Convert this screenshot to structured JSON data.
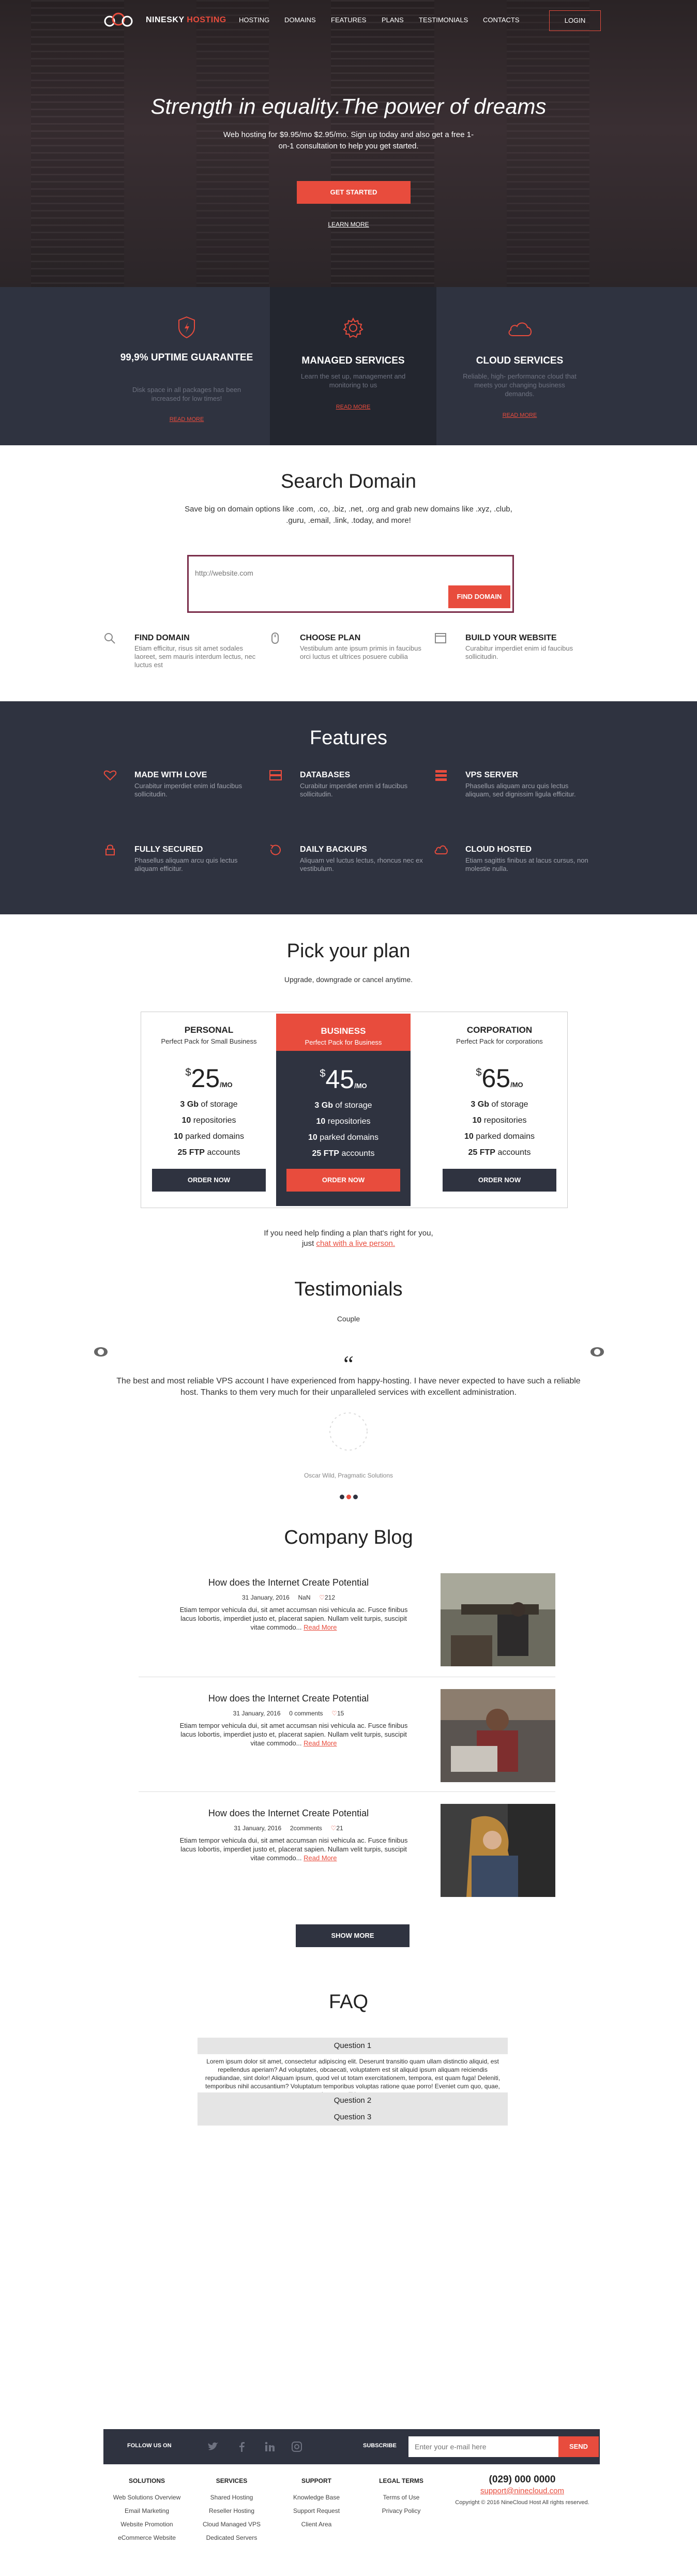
{
  "brand": {
    "name_part1": "NINESKY",
    "name_part2": "HOSTING"
  },
  "nav": {
    "items": [
      "HOSTING",
      "DOMAINS",
      "FEATURES",
      "PLANS",
      "TESTIMONIALS",
      "CONTACTS"
    ],
    "login": "LOGIN"
  },
  "hero": {
    "title": "Strength in equality.The power of dreams",
    "subtitle": "Web hosting for $9.95/mo $2.95/mo. Sign up today and also get a free 1-on-1 consultation to help you get started.",
    "cta": "GET STARTED",
    "learn_more": "LEARN MORE"
  },
  "services": [
    {
      "icon": "shield-icon",
      "title": "99,9% UPTIME GUARANTEE",
      "desc": "Disk space in all packages has been increased for low times!",
      "read": "READ MORE"
    },
    {
      "icon": "gear-icon",
      "title": "MANAGED SERVICES",
      "desc": "Learn the set up, management and monitoring to us",
      "read": "READ MORE"
    },
    {
      "icon": "cloud-icon",
      "title": "CLOUD SERVICES",
      "desc": "Reliable, high- performance cloud that meets your changing business demands.",
      "read": "READ MORE"
    }
  ],
  "search": {
    "title": "Search Domain",
    "desc": "Save big on domain options like .com, .co, .biz, .net, .org and grab new domains like .xyz, .club, .guru, .email, .link, .today, and more!",
    "placeholder": "http://website.com",
    "button": "FIND DOMAIN",
    "steps": [
      {
        "icon": "search-icon",
        "title": "FIND DOMAIN",
        "desc": "Etiam efficitur, risus sit amet sodales laoreet, sem mauris interdum lectus, nec luctus est"
      },
      {
        "icon": "mouse-icon",
        "title": "CHOOSE PLAN",
        "desc": "Vestibulum ante ipsum primis in faucibus orci luctus et ultrices posuere cubilia"
      },
      {
        "icon": "browser-icon",
        "title": "BUILD YOUR WEBSITE",
        "desc": "Curabitur imperdiet enim id faucibus sollicitudin."
      }
    ]
  },
  "features": {
    "title": "Features",
    "items": [
      {
        "icon": "heart-icon",
        "title": "MADE WITH LOVE",
        "desc": "Curabitur imperdiet enim id faucibus sollicitudin."
      },
      {
        "icon": "database-icon",
        "title": "DATABASES",
        "desc": "Curabitur imperdiet enim id faucibus sollicitudin."
      },
      {
        "icon": "server-icon",
        "title": "VPS SERVER",
        "desc": "Phasellus aliquam arcu quis lectus aliquam, sed dignissim ligula efficitur."
      },
      {
        "icon": "lock-icon",
        "title": "FULLY SECURED",
        "desc": "Phasellus aliquam arcu quis lectus aliquam efficitur."
      },
      {
        "icon": "backup-icon",
        "title": "DAILY BACKUPS",
        "desc": "Aliquam vel luctus lectus, rhoncus nec ex vestibulum."
      },
      {
        "icon": "cloud-icon",
        "title": "CLOUD HOSTED",
        "desc": "Etiam sagittis finibus at lacus cursus, non molestie nulla."
      }
    ]
  },
  "plans": {
    "title": "Pick your plan",
    "subtitle": "Upgrade, downgrade or cancel anytime.",
    "items": [
      {
        "name": "PERSONAL",
        "sub": "Perfect Pack for Small Business",
        "price": "25",
        "per": "/MO",
        "storage": "3 Gb",
        "storage_label": "of storage",
        "repos": "10",
        "repos_label": "repositories",
        "domains": "10",
        "domains_label": "parked domains",
        "ftp": "25 FTP",
        "ftp_label": "accounts",
        "order": "ORDER NOW"
      },
      {
        "name": "BUSINESS",
        "sub": "Perfect Pack for Business",
        "price": "45",
        "per": "/MO",
        "storage": "3 Gb",
        "storage_label": "of storage",
        "repos": "10",
        "repos_label": "repositories",
        "domains": "10",
        "domains_label": "parked domains",
        "ftp": "25 FTP",
        "ftp_label": "accounts",
        "order": "ORDER NOW"
      },
      {
        "name": "CORPORATION",
        "sub": "Perfect Pack for corporations",
        "price": "65",
        "per": "/MO",
        "storage": "3 Gb",
        "storage_label": "of storage",
        "repos": "10",
        "repos_label": "repositories",
        "domains": "10",
        "domains_label": "parked domains",
        "ftp": "25 FTP",
        "ftp_label": "accounts",
        "order": "ORDER NOW"
      }
    ],
    "help_line1": "If you need help finding a plan that's right for you,",
    "help_line2_prefix": "just",
    "help_link": "chat with a live person."
  },
  "testimonials": {
    "title": "Testimonials",
    "subtitle": "Couple",
    "text": "The best and most reliable VPS account I have experienced from happy-hosting. I have never expected to have such a reliable host. Thanks to them very much for their unparalleled services with excellent administration.",
    "author": "Oscar Wild, Pragmatic Solutions"
  },
  "blog": {
    "title": "Company Blog",
    "posts": [
      {
        "title": "How does the Internet Create Potential",
        "date": "31 January, 2016",
        "comments": "NaN",
        "likes": "212",
        "excerpt": "Etiam tempor vehicula dui, sit amet accumsan nisi vehicula ac. Fusce finibus lacus lobortis, imperdiet justo et, placerat sapien. Nullam velit turpis, suscipit vitae commodo...",
        "read": "Read More"
      },
      {
        "title": "How does the Internet Create Potential",
        "date": "31 January, 2016",
        "comments": "0 comments",
        "likes": "15",
        "excerpt": "Etiam tempor vehicula dui, sit amet accumsan nisi vehicula ac. Fusce finibus lacus lobortis, imperdiet justo et, placerat sapien. Nullam velit turpis, suscipit vitae commodo...",
        "read": "Read More"
      },
      {
        "title": "How does the Internet Create Potential",
        "date": "31 January, 2016",
        "comments": "2comments",
        "likes": "21",
        "excerpt": "Etiam tempor vehicula dui, sit amet accumsan nisi vehicula ac. Fusce finibus lacus lobortis, imperdiet justo et, placerat sapien. Nullam velit turpis, suscipit vitae commodo...",
        "read": "Read More"
      }
    ],
    "show_more": "SHOW MORE"
  },
  "faq": {
    "title": "FAQ",
    "q1": "Question 1",
    "a1": "Lorem ipsum dolor sit amet, consectetur adipiscing elit. Deserunt transitio quam ullam distinctio aliquid, est repellendus aperiam? Ad voluptates, obcaecati, voluptatem est sit aliquid ipsum aliquam reiciendis repudiandae, sint dolor! Aliquam ipsum, quod vel ut totam exercitationem, tempora, est quam fuga! Deleniti, temporibus nihil accusantium? Voluptatum temporibus voluptas ratione quae porro! Eveniet cum quo, quae, ipsum mollitia quaerat.",
    "q2": "Question 2",
    "q3": "Question 3"
  },
  "footer": {
    "follow": "FOLLOW US ON",
    "subscribe": "SUBSCRIBE",
    "email_placeholder": "Enter your e-mail here",
    "send": "SEND",
    "cols": [
      {
        "head": "SOLUTIONS",
        "items": [
          "Web Solutions Overview",
          "Email Marketing",
          "Website Promotion",
          "eCommerce Website"
        ]
      },
      {
        "head": "SERVICES",
        "items": [
          "Shared Hosting",
          "Reseller Hosting",
          "Cloud Managed VPS",
          "Dedicated Servers"
        ]
      },
      {
        "head": "SUPPORT",
        "items": [
          "Knowledge Base",
          "Support Request",
          "Client Area"
        ]
      },
      {
        "head": "LEGAL TERMS",
        "items": [
          "Terms of Use",
          "Privacy Policy"
        ]
      }
    ],
    "phone": "(029) 000 0000",
    "email": "support@ninecloud.com",
    "copyright": "Copyright © 2016 NineCloud Host All rights reserved."
  },
  "colors": {
    "accent": "#e84c3d",
    "dark": "#2f3340",
    "darker": "#23262f"
  }
}
